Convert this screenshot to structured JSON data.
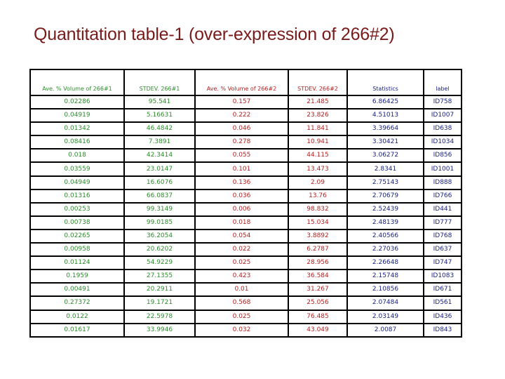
{
  "title": "Quantitation table-1 (over-expression of 266#2)",
  "colors": {
    "group1": "#2e8b2e",
    "group2": "#b22222",
    "stats": "#1a237e",
    "title": "#7a1b1b"
  },
  "table": {
    "headers": [
      "Ave. % Volume of 266#1",
      "STDEV. 266#1",
      "Ave. % Volume of 266#2",
      "STDEV. 266#2",
      "Statistics",
      "label"
    ],
    "rows": [
      [
        "0.02286",
        "95.541",
        "0.157",
        "21.485",
        "6.86425",
        "ID758"
      ],
      [
        "0.04919",
        "5.16631",
        "0.222",
        "23.826",
        "4.51013",
        "ID1007"
      ],
      [
        "0.01342",
        "46.4842",
        "0.046",
        "11.841",
        "3.39664",
        "ID638"
      ],
      [
        "0.08416",
        "7.3891",
        "0.278",
        "10.941",
        "3.30421",
        "ID1034"
      ],
      [
        "0.018",
        "42.3414",
        "0.055",
        "44.115",
        "3.06272",
        "ID856"
      ],
      [
        "0.03559",
        "23.0147",
        "0.101",
        "13.473",
        "2.8341",
        "ID1001"
      ],
      [
        "0.04949",
        "16.6076",
        "0.136",
        "2.09",
        "2.75143",
        "ID888"
      ],
      [
        "0.01316",
        "66.0837",
        "0.036",
        "13.76",
        "2.70679",
        "ID766"
      ],
      [
        "0.00253",
        "99.3149",
        "0.006",
        "98.832",
        "2.52439",
        "ID441"
      ],
      [
        "0.00738",
        "99.0185",
        "0.018",
        "15.034",
        "2.48139",
        "ID777"
      ],
      [
        "0.02265",
        "36.2054",
        "0.054",
        "3.8892",
        "2.40566",
        "ID768"
      ],
      [
        "0.00958",
        "20.6202",
        "0.022",
        "6.2787",
        "2.27036",
        "ID637"
      ],
      [
        "0.01124",
        "54.9229",
        "0.025",
        "28.956",
        "2.26648",
        "ID747"
      ],
      [
        "0.1959",
        "27.1355",
        "0.423",
        "36.584",
        "2.15748",
        "ID1083"
      ],
      [
        "0.00491",
        "20.2911",
        "0.01",
        "31.267",
        "2.10856",
        "ID671"
      ],
      [
        "0.27372",
        "19.1721",
        "0.568",
        "25.056",
        "2.07484",
        "ID561"
      ],
      [
        "0.0122",
        "22.5978",
        "0.025",
        "76.485",
        "2.03149",
        "ID436"
      ],
      [
        "0.01617",
        "33.9946",
        "0.032",
        "43.049",
        "2.0087",
        "ID843"
      ]
    ]
  }
}
